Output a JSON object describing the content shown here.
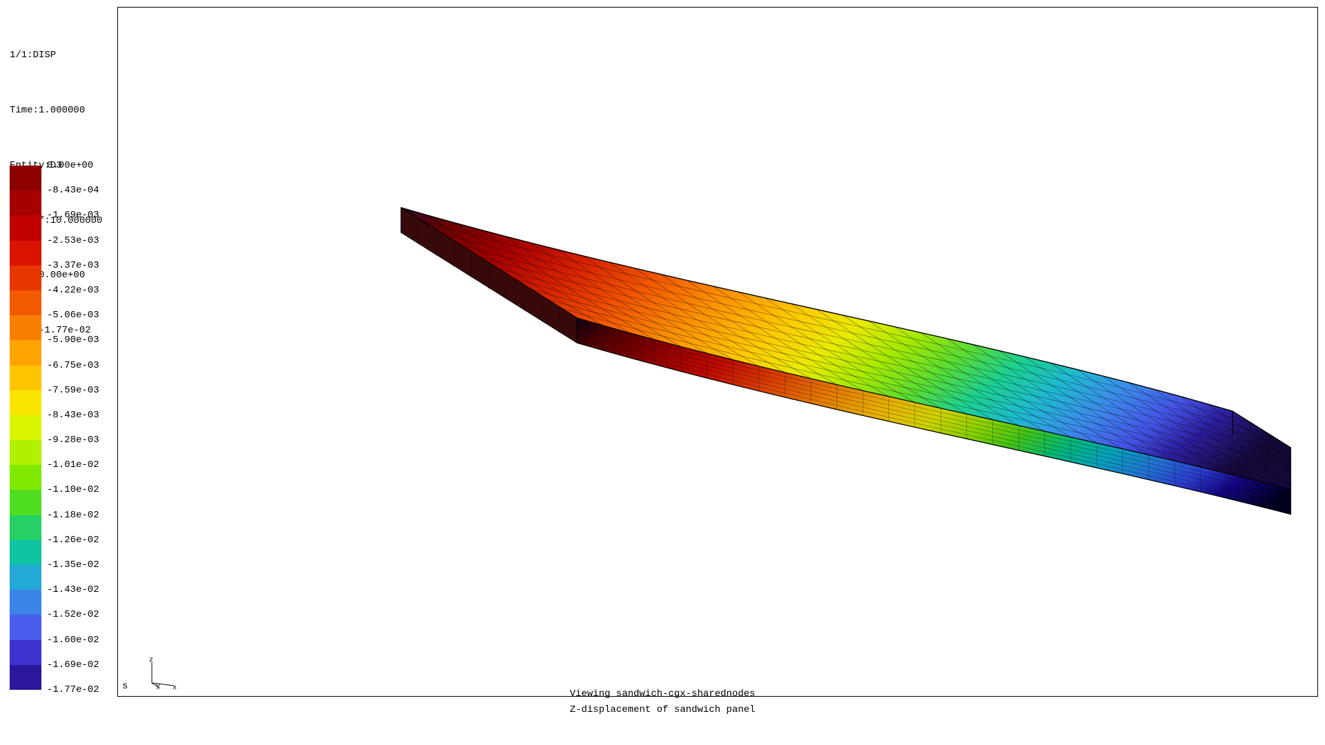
{
  "header": {
    "step": "1/1:DISP",
    "time": "Time:1.000000",
    "entity": "Entity:D3",
    "dispf": "+Dispf:10.000000",
    "max": "max: 0.00e+00",
    "min": "min: -1.77e-02"
  },
  "legend": {
    "labels": [
      "0.00e+00",
      "-8.43e-04",
      "-1.69e-03",
      "-2.53e-03",
      "-3.37e-03",
      "-4.22e-03",
      "-5.06e-03",
      "-5.90e-03",
      "-6.75e-03",
      "-7.59e-03",
      "-8.43e-03",
      "-9.28e-03",
      "-1.01e-02",
      "-1.10e-02",
      "-1.18e-02",
      "-1.26e-02",
      "-1.35e-02",
      "-1.43e-02",
      "-1.52e-02",
      "-1.60e-02",
      "-1.69e-02",
      "-1.77e-02"
    ],
    "colors": [
      "#8c0000",
      "#a60000",
      "#c10000",
      "#db1400",
      "#e83600",
      "#f25a00",
      "#f97f00",
      "#fea300",
      "#ffc500",
      "#f9e600",
      "#d9f500",
      "#aef200",
      "#7fe900",
      "#4fdd1f",
      "#25d164",
      "#0fc3a3",
      "#23a9d6",
      "#3b84e8",
      "#4a5ceb",
      "#3d33cf",
      "#2a179b"
    ]
  },
  "axis": {
    "x": "x",
    "y": "y",
    "z": "z"
  },
  "footer": {
    "line1": "Viewing sandwich-cgx-sharednodes",
    "line2": "Z-displacement of sandwich panel"
  },
  "origin_label": "s",
  "mesh": {
    "cols": 32,
    "rows": 10,
    "thickness_layers": 6,
    "gradient_stops": [
      {
        "offset": "0%",
        "color": "#2a0a2f"
      },
      {
        "offset": "6%",
        "color": "#6b0000"
      },
      {
        "offset": "14%",
        "color": "#a80000"
      },
      {
        "offset": "22%",
        "color": "#d82400"
      },
      {
        "offset": "30%",
        "color": "#f25a00"
      },
      {
        "offset": "38%",
        "color": "#fd9600"
      },
      {
        "offset": "46%",
        "color": "#ffcc00"
      },
      {
        "offset": "52%",
        "color": "#e8ea00"
      },
      {
        "offset": "58%",
        "color": "#a7e900"
      },
      {
        "offset": "64%",
        "color": "#5bdc30"
      },
      {
        "offset": "70%",
        "color": "#1cd090"
      },
      {
        "offset": "76%",
        "color": "#1fb8d2"
      },
      {
        "offset": "82%",
        "color": "#3c8aea"
      },
      {
        "offset": "88%",
        "color": "#4454e4"
      },
      {
        "offset": "93%",
        "color": "#2d1f9e"
      },
      {
        "offset": "100%",
        "color": "#16083a"
      }
    ]
  }
}
